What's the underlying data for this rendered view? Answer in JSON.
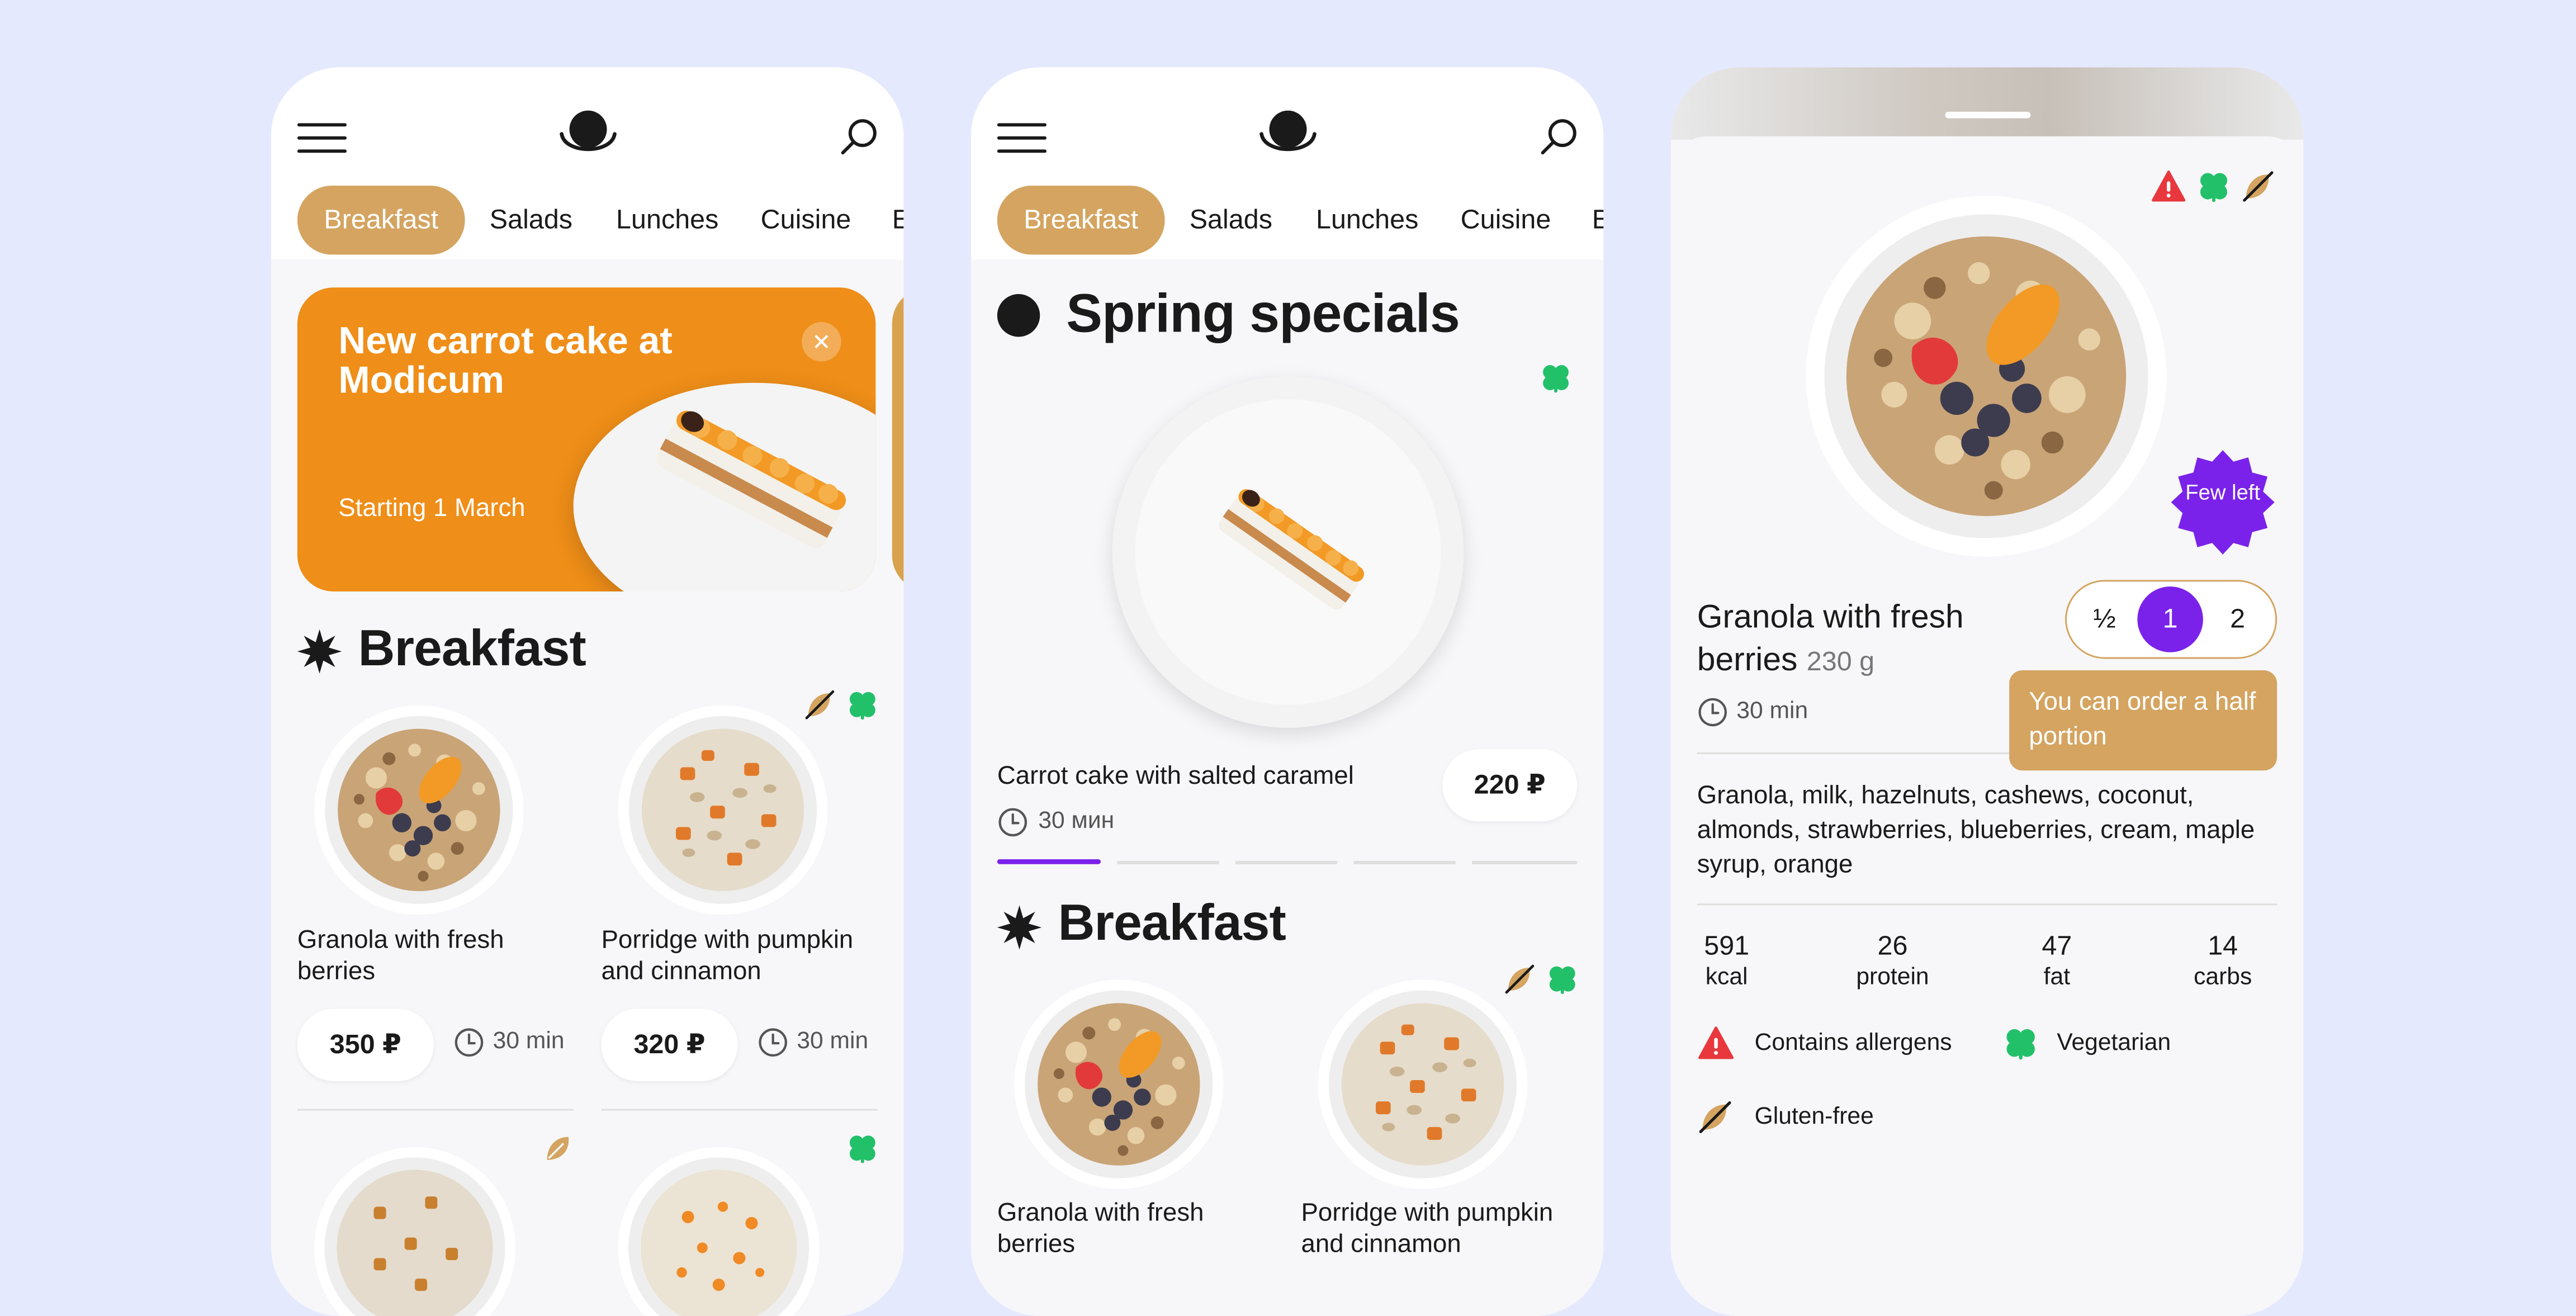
{
  "nav_tabs": [
    "Breakfast",
    "Salads",
    "Lunches",
    "Cuisine",
    "E"
  ],
  "screen1": {
    "promo": {
      "title": "New carrot cake at Modicum",
      "subtitle": "Starting 1 March"
    },
    "section_title": "Breakfast",
    "cards": [
      {
        "name": "Granola with fresh berries",
        "price": "350 ₽",
        "time": "30 min"
      },
      {
        "name": "Porridge with pumpkin and cinnamon",
        "price": "320 ₽",
        "time": "30 min"
      }
    ]
  },
  "screen2": {
    "specials_title": "Spring specials",
    "special_item": {
      "name": "Carrot cake with salted caramel",
      "time": "30 мин",
      "price": "220 ₽"
    },
    "section_title": "Breakfast",
    "cards": [
      {
        "name": "Granola with fresh berries"
      },
      {
        "name": "Porridge with pumpkin and cinnamon"
      }
    ]
  },
  "screen3": {
    "name": "Granola with fresh berries",
    "weight": "230 g",
    "time": "30 min",
    "badge": "Few left",
    "portion_options": [
      "½",
      "1",
      "2"
    ],
    "portion_selected": "1",
    "tooltip": "You can order a half portion",
    "ingredients": "Granola, milk, hazelnuts, cashews, coconut, almonds, strawberries, blueberries, cream, maple syrup, orange",
    "nutrition": [
      {
        "value": "591",
        "label": "kcal"
      },
      {
        "value": "26",
        "label": "protein"
      },
      {
        "value": "47",
        "label": "fat"
      },
      {
        "value": "14",
        "label": "carbs"
      }
    ],
    "tags": [
      "Contains allergens",
      "Vegetarian",
      "Gluten-free"
    ]
  },
  "icons": [
    "menu-icon",
    "logo-icon",
    "search-icon",
    "close-icon",
    "clock-icon",
    "gluten-free-icon",
    "vegetarian-icon",
    "allergen-icon",
    "starburst-icon",
    "dot-icon",
    "few-left-badge",
    "drag-handle"
  ],
  "colors": {
    "background": "#e5e9fd",
    "accent_tan": "#d4a460",
    "promo_orange": "#ef8e18",
    "purple": "#7a22ea",
    "vegetarian_green": "#23c06a",
    "allergen_red": "#e8383d"
  }
}
